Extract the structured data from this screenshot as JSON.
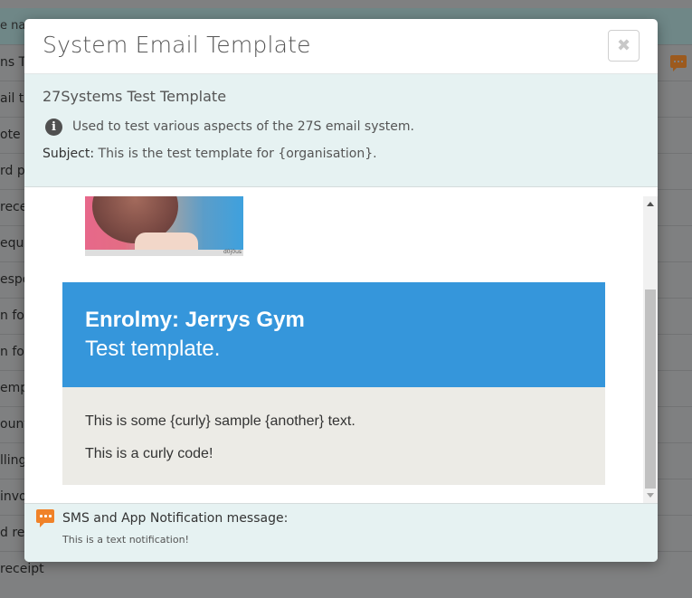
{
  "background": {
    "header_text": "e nam",
    "rows": [
      "ns Te",
      "ail te",
      "ote te",
      "rd p",
      "recei",
      "equ",
      "espo",
      "n for",
      "n for",
      "empl",
      "ount",
      "lling",
      "invo",
      "d res",
      "receipt"
    ]
  },
  "modal": {
    "title": "System Email Template",
    "close_icon": "close-icon",
    "template_name": "27Systems Test Template",
    "info_icon": "i",
    "description": "Used to test various aspects of the 27S email system.",
    "subject_label": "Subject:",
    "subject_value": " This is the test template for {organisation}."
  },
  "email_preview": {
    "photo_watermark": "d0j0us",
    "brand": "Enrolmy: Jerrys Gym",
    "subtitle": "Test template.",
    "body_lines": [
      "This is some {curly} sample {another} text.",
      "This is a curly code!"
    ],
    "header_color": "#3596db",
    "body_color": "#ecebe6"
  },
  "footer": {
    "label": "SMS and App Notification message:",
    "text": "This is a text notification!",
    "icon_color": "#f08228"
  }
}
